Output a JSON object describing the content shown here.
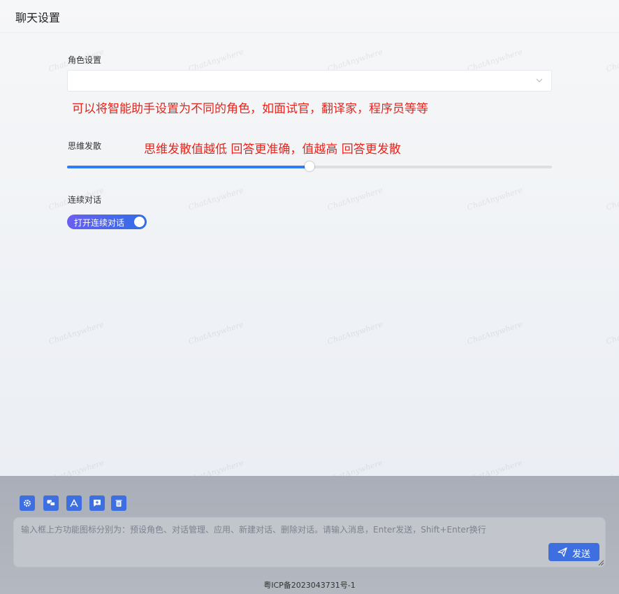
{
  "header": {
    "title": "聊天设置"
  },
  "watermark_text": "ChatAnywhere",
  "settings": {
    "role": {
      "label": "角色设置",
      "value": "",
      "annotation": "可以将智能助手设置为不同的角色，如面试官，翻译家，程序员等等"
    },
    "divergence": {
      "label": "思维发散",
      "annotation": "思维发散值越低 回答更准确，值越高 回答更发散",
      "value_fraction": 0.5
    },
    "continuous": {
      "label": "连续对话",
      "toggle_label": "打开连续对话",
      "enabled": true
    }
  },
  "toolbar": {
    "icons": [
      "gear-icon",
      "chats-icon",
      "apps-icon",
      "new-chat-icon",
      "delete-icon"
    ]
  },
  "chat_input": {
    "placeholder": "输入框上方功能图标分别为：预设角色、对话管理、应用、新建对话、删除对话。请输入消息，Enter发送，Shift+Enter换行",
    "send_label": "发送"
  },
  "footer": {
    "icp": "粤ICP备2023043731号-1"
  },
  "colors": {
    "accent": "#3d6fe0",
    "annotation": "#e8241c",
    "slider": "#2f7cf6"
  }
}
